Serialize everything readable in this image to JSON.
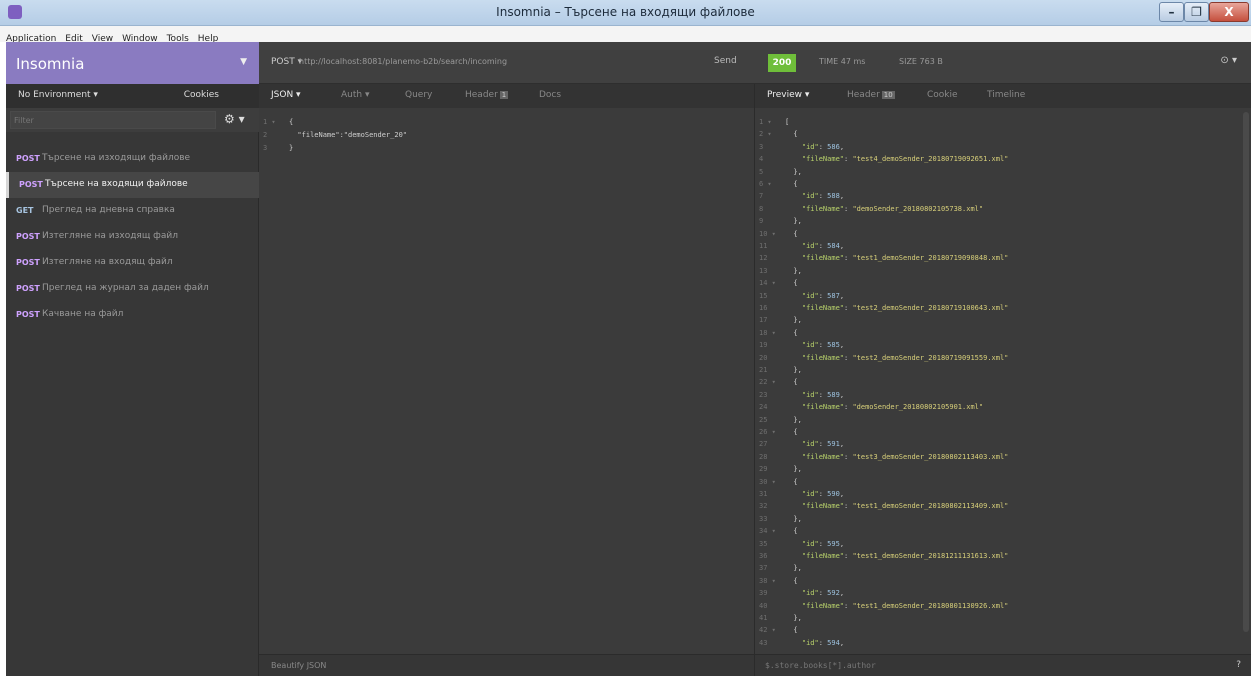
{
  "window": {
    "title": "Insomnia – Търсене на входящи файлове",
    "min": "–",
    "max": "❐",
    "close": "X"
  },
  "menu": [
    "Application",
    "Edit",
    "View",
    "Window",
    "Tools",
    "Help"
  ],
  "sidebar": {
    "brand": "Insomnia",
    "environment": "No Environment ▾",
    "cookies": "Cookies",
    "filter_placeholder": "Filter",
    "requests": [
      {
        "method": "POST",
        "label": "Търсене на изходящи файлове",
        "active": false
      },
      {
        "method": "POST",
        "label": "Търсене на входящи файлове",
        "active": true
      },
      {
        "method": "GET",
        "label": "Преглед на дневна справка",
        "active": false
      },
      {
        "method": "POST",
        "label": "Изтегляне на изходящ файл",
        "active": false
      },
      {
        "method": "POST",
        "label": "Изтегляне на входящ файл",
        "active": false
      },
      {
        "method": "POST",
        "label": "Преглед на журнал за даден файл",
        "active": false
      },
      {
        "method": "POST",
        "label": "Качване на файл",
        "active": false
      }
    ]
  },
  "urlbar": {
    "method": "POST ▾",
    "url": "http://localhost:8081/planemo-b2b/search/incoming",
    "send": "Send",
    "status": "200",
    "time": "TIME 47 ms",
    "size": "SIZE 763 B",
    "history": "⊙ ▾"
  },
  "request": {
    "tabs": [
      {
        "label": "JSON ▾",
        "active": true
      },
      {
        "label": "Auth ▾",
        "active": false
      },
      {
        "label": "Query",
        "active": false
      },
      {
        "label": "Header",
        "badge": "1",
        "active": false
      },
      {
        "label": "Docs",
        "active": false
      }
    ],
    "body_lines": [
      "{",
      "  \"fileName\":\"demoSender_20\"",
      "}"
    ],
    "footer": "Beautify JSON"
  },
  "response": {
    "tabs": [
      {
        "label": "Preview ▾",
        "active": true
      },
      {
        "label": "Header",
        "badge": "10",
        "active": false
      },
      {
        "label": "Cookie",
        "active": false
      },
      {
        "label": "Timeline",
        "active": false
      }
    ],
    "items": [
      {
        "id": 586,
        "fileName": "test4_demoSender_20180719092651.xml"
      },
      {
        "id": 588,
        "fileName": "demoSender_20180802105738.xml"
      },
      {
        "id": 584,
        "fileName": "test1_demoSender_20180719090848.xml"
      },
      {
        "id": 587,
        "fileName": "test2_demoSender_20180719100643.xml"
      },
      {
        "id": 585,
        "fileName": "test2_demoSender_20180719091559.xml"
      },
      {
        "id": 589,
        "fileName": "demoSender_20180802105901.xml"
      },
      {
        "id": 591,
        "fileName": "test3_demoSender_20180802113403.xml"
      },
      {
        "id": 590,
        "fileName": "test1_demoSender_20180802113409.xml"
      },
      {
        "id": 595,
        "fileName": "test1_demoSender_20181211131613.xml"
      },
      {
        "id": 592,
        "fileName": "test1_demoSender_20180801130926.xml"
      },
      {
        "id": 594,
        "fileName": ""
      }
    ],
    "filter_placeholder": "$.store.books[*].author",
    "help": "?"
  },
  "colors": {
    "brand": "#8a7bc1",
    "status_ok": "#6fbe3a",
    "post": "#cfa2ff",
    "get": "#a7c4e0"
  }
}
